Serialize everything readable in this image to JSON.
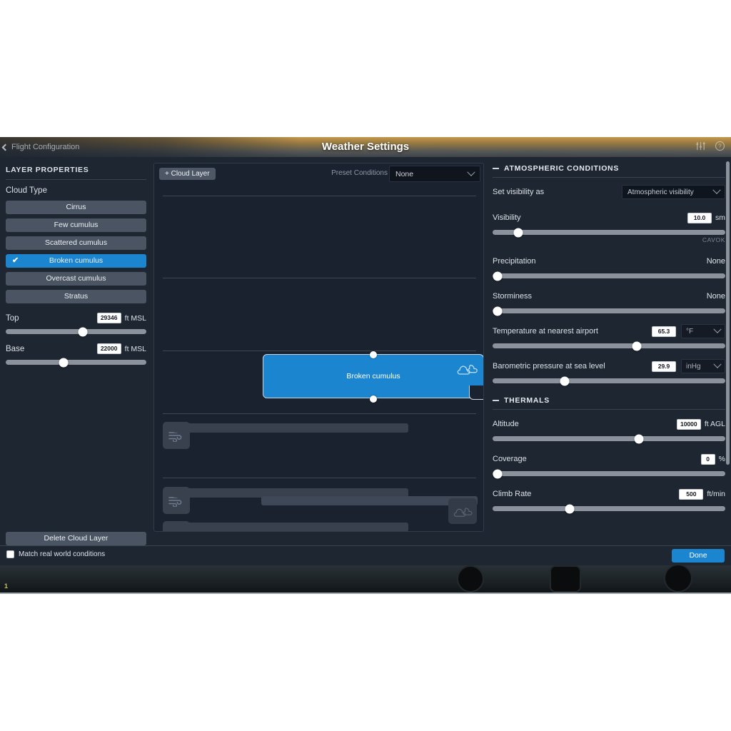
{
  "titlebar": {
    "back_label": "Flight Configuration",
    "title": "Weather Settings",
    "icons": {
      "sliders": "sliders-icon",
      "help": "help-icon"
    }
  },
  "left_panel": {
    "section_title": "LAYER PROPERTIES",
    "cloud_type_label": "Cloud Type",
    "cloud_types": [
      {
        "label": "Cirrus",
        "selected": false
      },
      {
        "label": "Few cumulus",
        "selected": false
      },
      {
        "label": "Scattered cumulus",
        "selected": false
      },
      {
        "label": "Broken cumulus",
        "selected": true
      },
      {
        "label": "Overcast cumulus",
        "selected": false
      },
      {
        "label": "Stratus",
        "selected": false
      }
    ],
    "check_glyph": "✔",
    "top": {
      "label": "Top",
      "value": "29346",
      "unit": "ft MSL",
      "knob_pct": 55
    },
    "base": {
      "label": "Base",
      "value": "22000",
      "unit": "ft MSL",
      "knob_pct": 41
    },
    "delete_label": "Delete Cloud Layer"
  },
  "middle_panel": {
    "add_layer_label": "+ Cloud Layer",
    "preset_label": "Preset Conditions",
    "preset_value": "None",
    "cloud_layer": {
      "label": "Broken cumulus"
    }
  },
  "right_panel": {
    "atmospheric": {
      "heading": "ATMOSPHERIC CONDITIONS",
      "visibility_mode_label": "Set visibility as",
      "visibility_mode_value": "Atmospheric visibility",
      "visibility": {
        "label": "Visibility",
        "value": "10.0",
        "unit": "sm",
        "knob_pct": 11,
        "note": "CAVOK"
      },
      "precipitation": {
        "label": "Precipitation",
        "value": "None",
        "knob_pct": 2
      },
      "storminess": {
        "label": "Storminess",
        "value": "None",
        "knob_pct": 2
      },
      "temperature": {
        "label": "Temperature at nearest airport",
        "value": "65.3",
        "unit": "°F",
        "knob_pct": 62
      },
      "pressure": {
        "label": "Barometric pressure at sea level",
        "value": "29.9",
        "unit": "inHg",
        "knob_pct": 31
      }
    },
    "thermals": {
      "heading": "THERMALS",
      "altitude": {
        "label": "Altitude",
        "value": "10000",
        "unit": "ft AGL",
        "knob_pct": 63
      },
      "coverage": {
        "label": "Coverage",
        "value": "0",
        "unit": "%",
        "knob_pct": 2
      },
      "climb_rate": {
        "label": "Climb Rate",
        "value": "500",
        "unit": "ft/min",
        "knob_pct": 33
      }
    }
  },
  "footer": {
    "match_label": "Match real world conditions",
    "match_checked": false,
    "done_label": "Done"
  },
  "background": {
    "hud_marker": "1"
  },
  "colors": {
    "accent": "#1b85d0",
    "panel": "#1e2632",
    "panel_dark": "#1a2230",
    "track": "#8b929b",
    "text": "#dbe0e6"
  }
}
